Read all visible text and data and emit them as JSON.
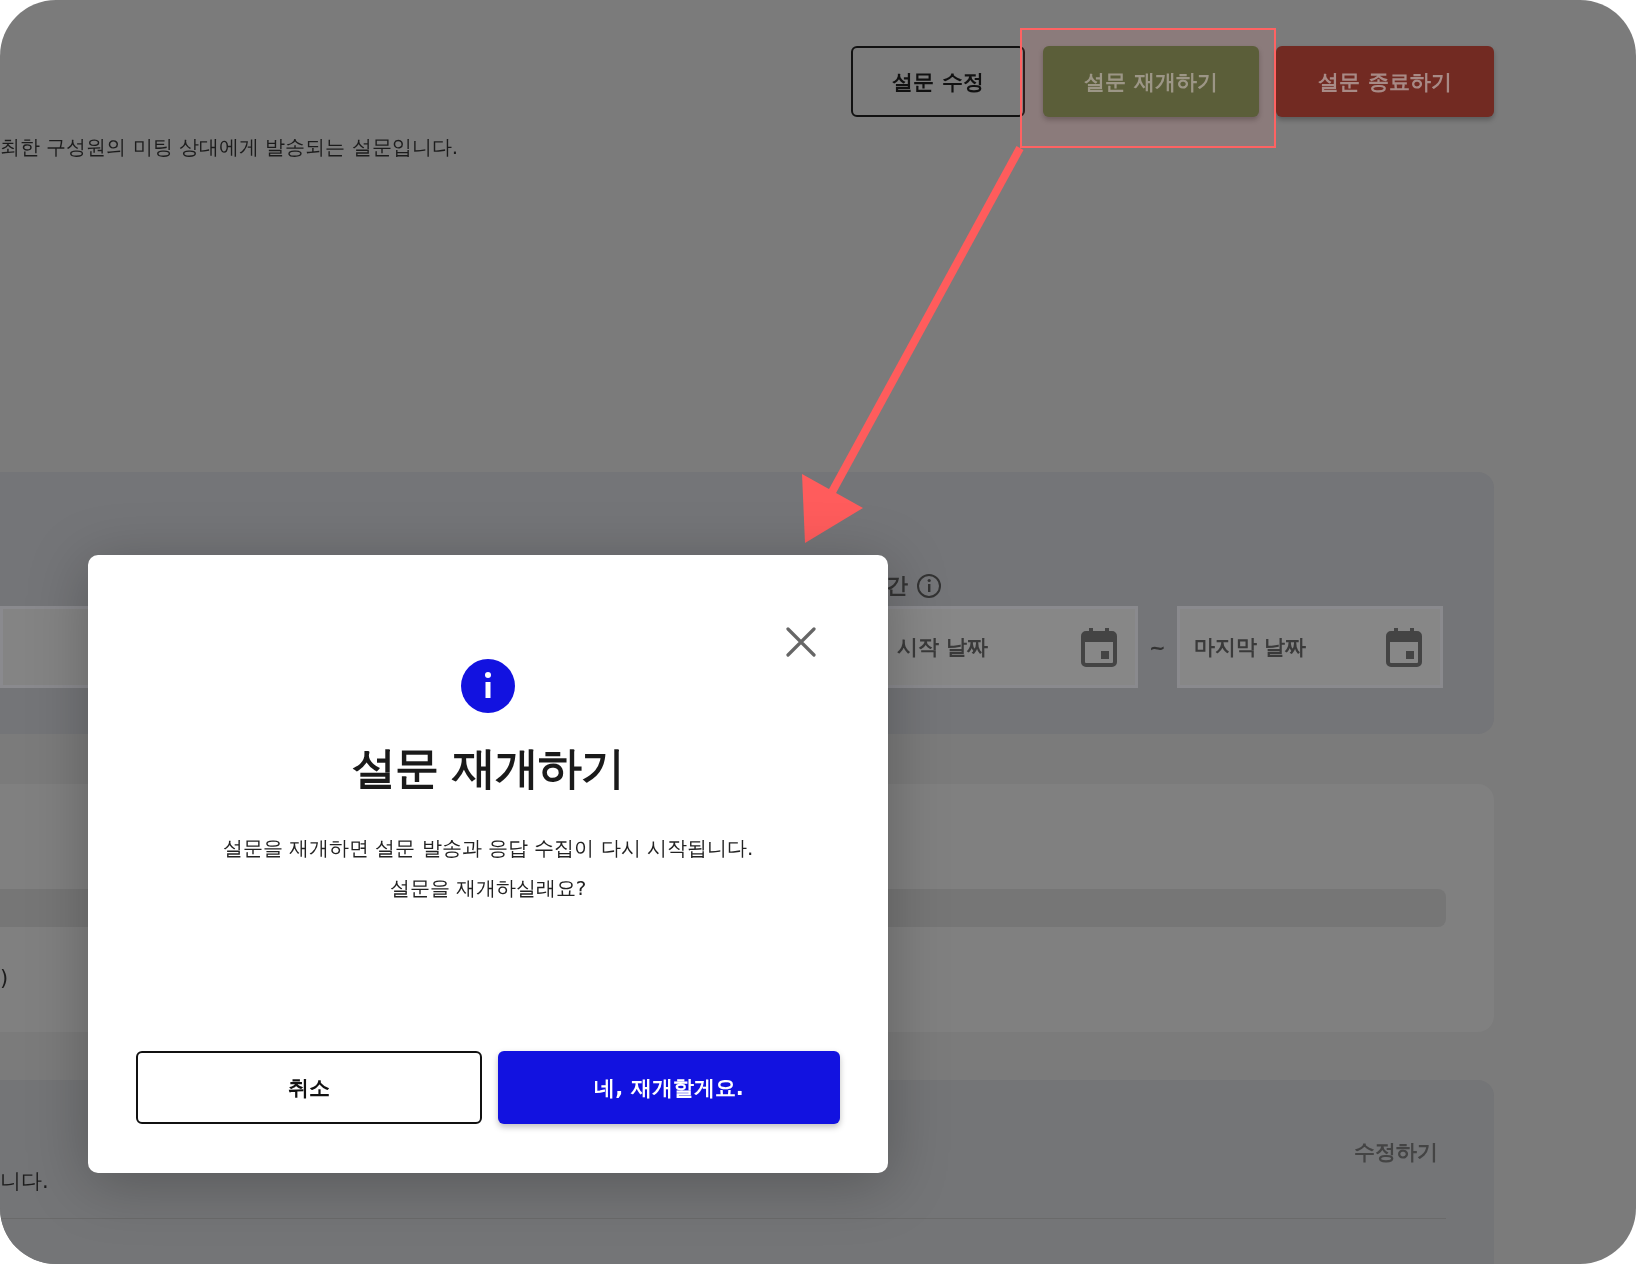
{
  "page": {
    "actions": [
      {
        "label": "설문 수정",
        "kind": "outline"
      },
      {
        "label": "설문 재개하기",
        "kind": "resume"
      },
      {
        "label": "설문 종료하기",
        "kind": "end"
      }
    ],
    "description": "최한 구성원의 미팅 상대에게 발송되는 설문입니다.",
    "period": {
      "label": "간",
      "start_placeholder": "시작 날짜",
      "separator": "~",
      "end_placeholder": "마지막 날짜"
    },
    "section_2": {
      "text": ")"
    },
    "section_3": {
      "edit_link": "수정하기",
      "text": "니다."
    }
  },
  "dialog": {
    "title": "설문 재개하기",
    "message": [
      "설문을 재개하면 설문 발송과 응답 수집이 다시 시작됩니다.",
      "설문을 재개하실래요?"
    ],
    "buttons": [
      {
        "label": "취소",
        "kind": "secondary"
      },
      {
        "label": "네, 재개할게요.",
        "kind": "primary"
      }
    ]
  }
}
